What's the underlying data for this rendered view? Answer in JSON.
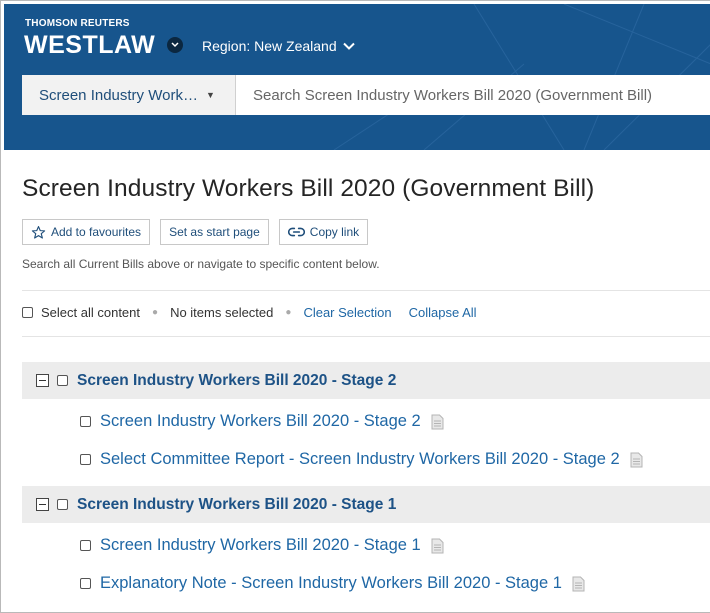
{
  "header": {
    "brand_small": "THOMSON REUTERS",
    "brand_big": "WESTLAW",
    "region_label": "Region: New Zealand",
    "scope_label": "Screen Industry Work…",
    "search_placeholder": "Search Screen Industry Workers Bill 2020 (Government Bill)"
  },
  "page": {
    "title": "Screen Industry Workers Bill 2020 (Government Bill)",
    "actions": {
      "favourites": "Add to favourites",
      "start_page": "Set as start page",
      "copy_link": "Copy link"
    },
    "helper_text": "Search all Current Bills above or navigate to specific content below."
  },
  "selection": {
    "select_all": "Select all content",
    "status": "No items selected",
    "clear": "Clear Selection",
    "collapse": "Collapse All"
  },
  "groups": [
    {
      "title": "Screen Industry Workers Bill 2020 - Stage 2",
      "items": [
        "Screen Industry Workers Bill 2020 - Stage 2",
        "Select Committee Report - Screen Industry Workers Bill 2020 - Stage 2"
      ]
    },
    {
      "title": "Screen Industry Workers Bill 2020 - Stage 1",
      "items": [
        "Screen Industry Workers Bill 2020 - Stage 1",
        "Explanatory Note - Screen Industry Workers Bill 2020 - Stage 1"
      ]
    }
  ],
  "colors": {
    "header_bg": "#17558d",
    "link": "#1f67a5",
    "group_title": "#1d5286"
  }
}
